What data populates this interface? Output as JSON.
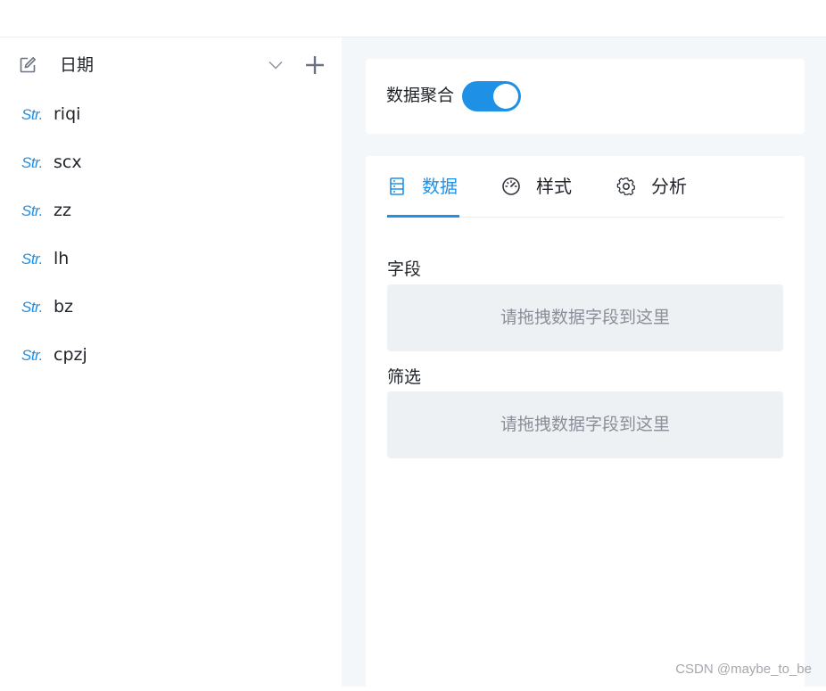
{
  "dataset": {
    "name": "日期",
    "icons": {
      "edit": "edit-icon",
      "expand": "chevron-down-icon",
      "add": "plus-icon"
    }
  },
  "fields": [
    {
      "type": "Str.",
      "name": "riqi"
    },
    {
      "type": "Str.",
      "name": "scx"
    },
    {
      "type": "Str.",
      "name": "zz"
    },
    {
      "type": "Str.",
      "name": "lh"
    },
    {
      "type": "Str.",
      "name": "bz"
    },
    {
      "type": "Str.",
      "name": "cpzj"
    }
  ],
  "aggregation": {
    "label": "数据聚合",
    "enabled": true
  },
  "tabs": [
    {
      "label": "数据",
      "icon": "data-table-icon",
      "active": true
    },
    {
      "label": "样式",
      "icon": "gauge-icon",
      "active": false
    },
    {
      "label": "分析",
      "icon": "gear-icon",
      "active": false
    }
  ],
  "sections": {
    "fields": {
      "label": "字段",
      "placeholder": "请拖拽数据字段到这里"
    },
    "filters": {
      "label": "筛选",
      "placeholder": "请拖拽数据字段到这里"
    }
  },
  "watermark": "CSDN @maybe_to_be",
  "colors": {
    "accent": "#1e90e6",
    "panel_bg": "#f4f7fa",
    "drop_zone_bg": "#eef1f4",
    "placeholder_text": "#8a8f99"
  }
}
